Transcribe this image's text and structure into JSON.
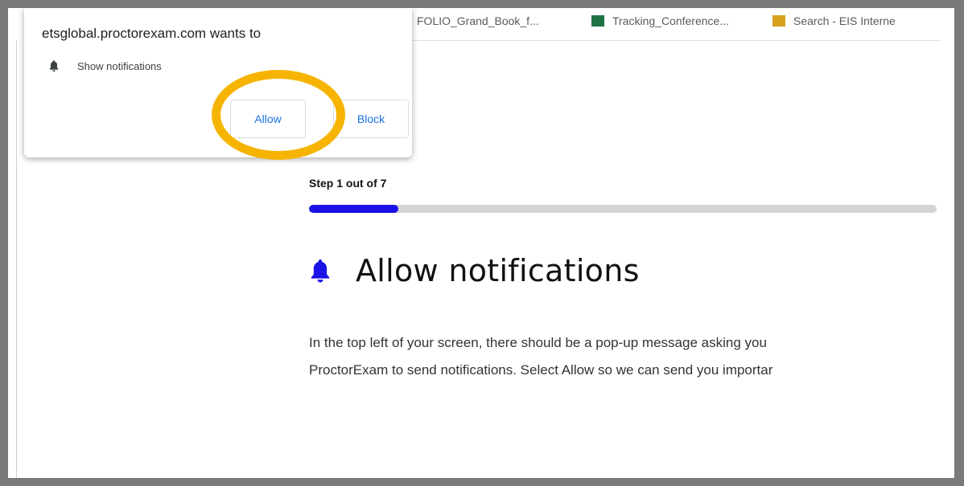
{
  "bookmarks": [
    {
      "label": "FOLIO_Grand_Book_f..."
    },
    {
      "label": "Tracking_Conference..."
    },
    {
      "label": "Search - EIS Interne"
    }
  ],
  "popup": {
    "title": "etsglobal.proctorexam.com wants to",
    "permission_icon": "bell-icon",
    "permission_label": "Show notifications",
    "allow_label": "Allow",
    "block_label": "Block"
  },
  "highlight_color": "#f6b400",
  "step": {
    "label": "Step 1 out of 7",
    "current": 1,
    "total": 7,
    "progress_color": "#1a12e6"
  },
  "content": {
    "heading_icon": "bell-icon",
    "heading": "Allow notifications",
    "line1": "In the top left of your screen, there should be a pop-up message asking you",
    "line2": "ProctorExam to send notifications. Select Allow so we can send you importar"
  }
}
